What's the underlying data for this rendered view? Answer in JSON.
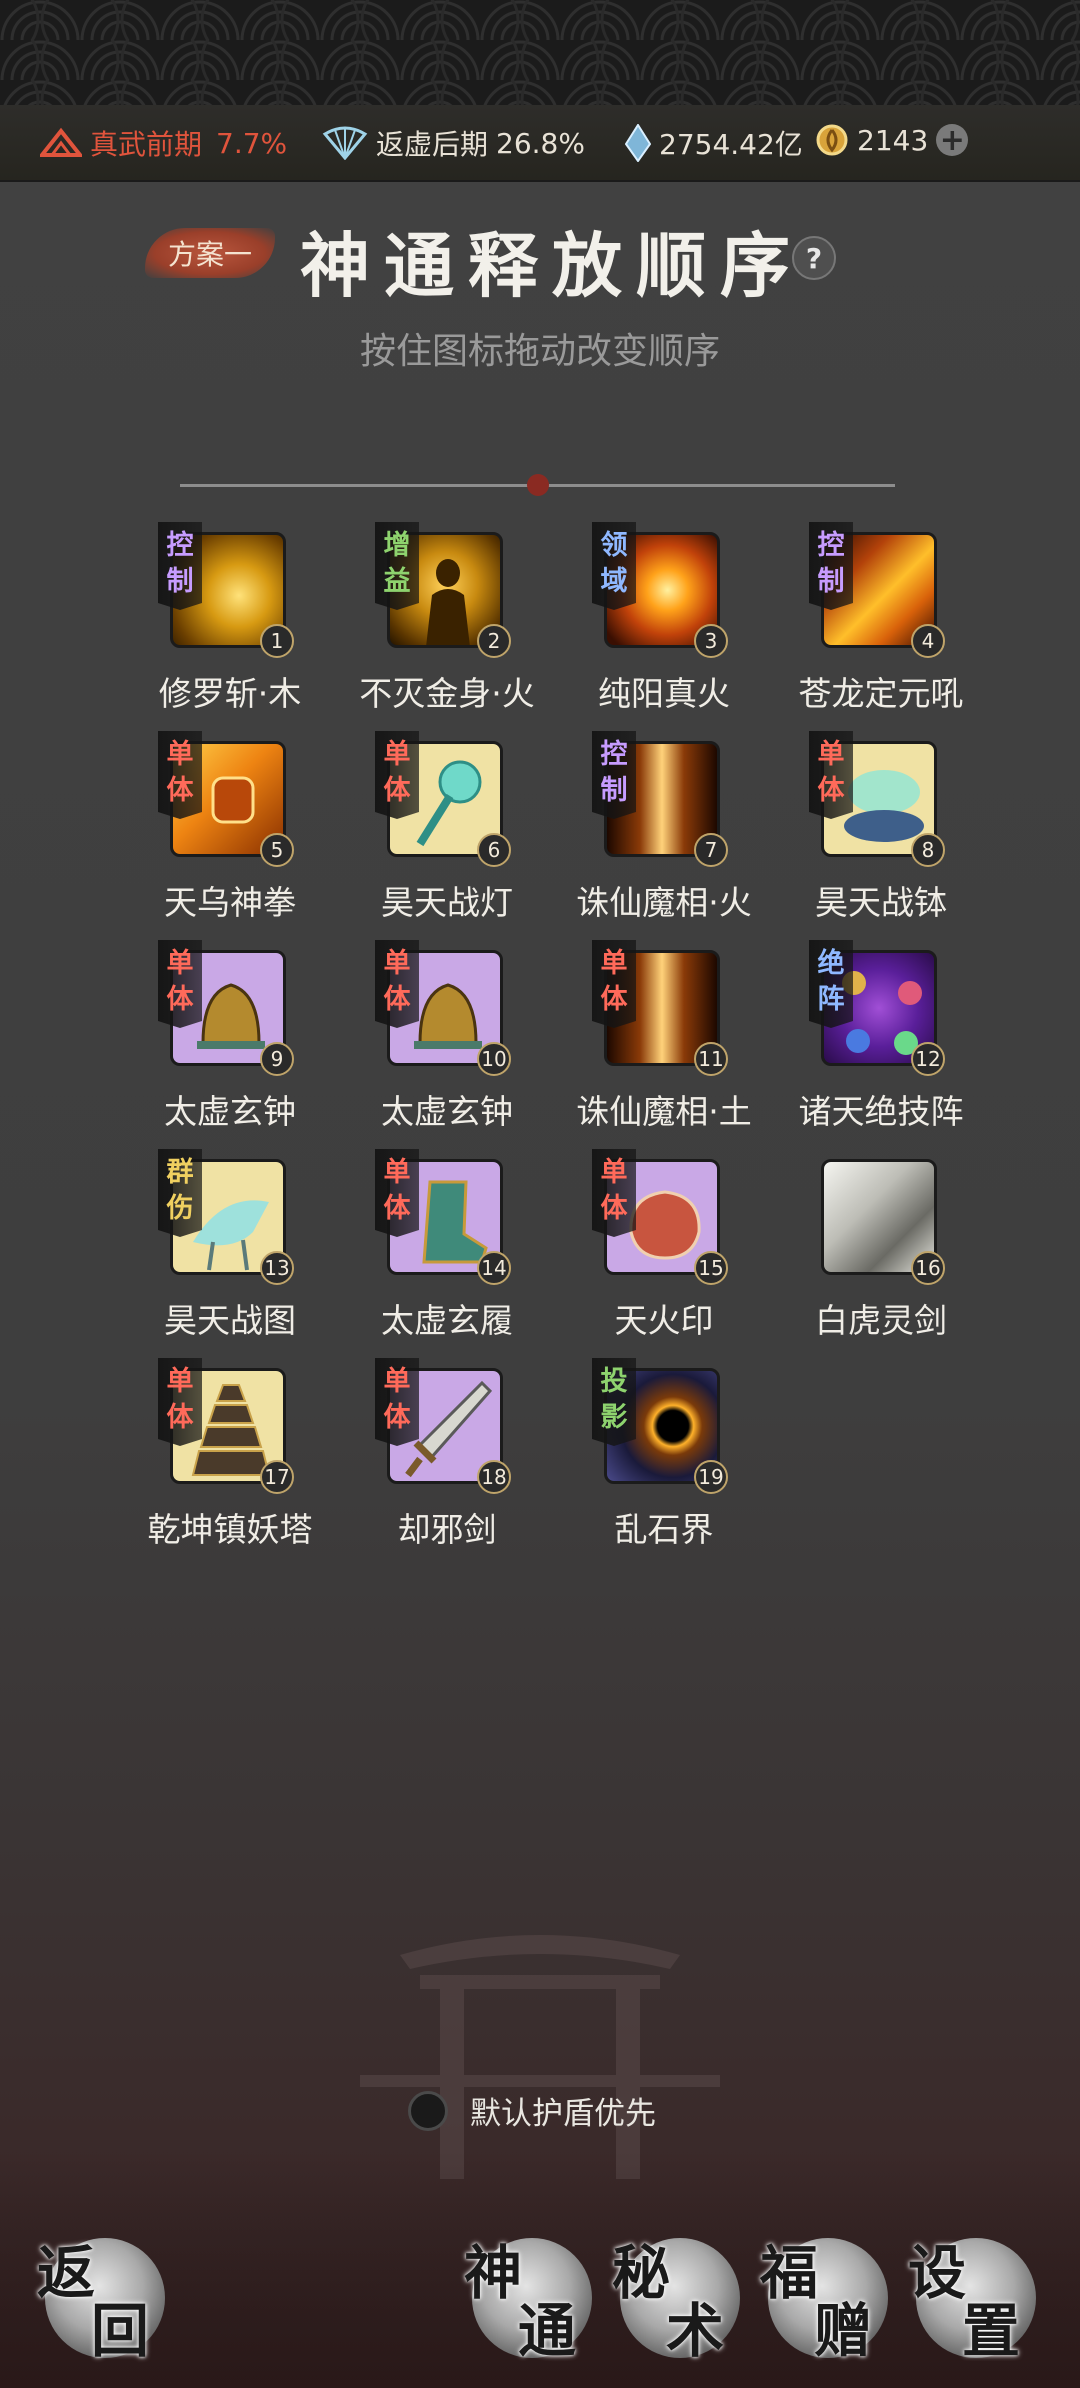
{
  "status": {
    "realm1_label": "真武前期",
    "realm1_pct": "7.7%",
    "realm2_label": "返虚后期",
    "realm2_pct": "26.8%",
    "spirit_stones": "2754.42亿",
    "gold": "2143"
  },
  "header": {
    "plan_label": "方案一",
    "title": "神通释放顺序",
    "help": "?",
    "subtitle": "按住图标拖动改变顺序"
  },
  "skills": [
    {
      "tag": "控制",
      "num": "1",
      "name": "修罗斩·木"
    },
    {
      "tag": "增益",
      "num": "2",
      "name": "不灭金身·火"
    },
    {
      "tag": "领域",
      "num": "3",
      "name": "纯阳真火"
    },
    {
      "tag": "控制",
      "num": "4",
      "name": "苍龙定元吼"
    },
    {
      "tag": "单体",
      "num": "5",
      "name": "天乌神拳"
    },
    {
      "tag": "单体",
      "num": "6",
      "name": "昊天战灯"
    },
    {
      "tag": "控制",
      "num": "7",
      "name": "诛仙魔相·火"
    },
    {
      "tag": "单体",
      "num": "8",
      "name": "昊天战钵"
    },
    {
      "tag": "单体",
      "num": "9",
      "name": "太虚玄钟"
    },
    {
      "tag": "单体",
      "num": "10",
      "name": "太虚玄钟"
    },
    {
      "tag": "单体",
      "num": "11",
      "name": "诛仙魔相·土"
    },
    {
      "tag": "绝阵",
      "num": "12",
      "name": "诸天绝技阵"
    },
    {
      "tag": "群伤",
      "num": "13",
      "name": "昊天战图"
    },
    {
      "tag": "单体",
      "num": "14",
      "name": "太虚玄履"
    },
    {
      "tag": "单体",
      "num": "15",
      "name": "天火印"
    },
    {
      "tag": "",
      "num": "16",
      "name": "白虎灵剑"
    },
    {
      "tag": "单体",
      "num": "17",
      "name": "乾坤镇妖塔"
    },
    {
      "tag": "单体",
      "num": "18",
      "name": "却邪剑"
    },
    {
      "tag": "投影",
      "num": "19",
      "name": "乱石界"
    }
  ],
  "shield_option": "默认护盾优先",
  "nav": {
    "back": [
      "返",
      "回"
    ],
    "shentong": [
      "神",
      "通"
    ],
    "mishu": [
      "秘",
      "术"
    ],
    "fuzeng": [
      "福",
      "赠"
    ],
    "settings": [
      "设",
      "置"
    ]
  },
  "colors": {
    "tag_control": "#c79cff",
    "tag_buff": "#8ed36e",
    "tag_domain": "#8fb8ff",
    "tag_single": "#ff6a5a",
    "tag_aoe": "#f0d060",
    "accent_red": "#e0543c"
  }
}
